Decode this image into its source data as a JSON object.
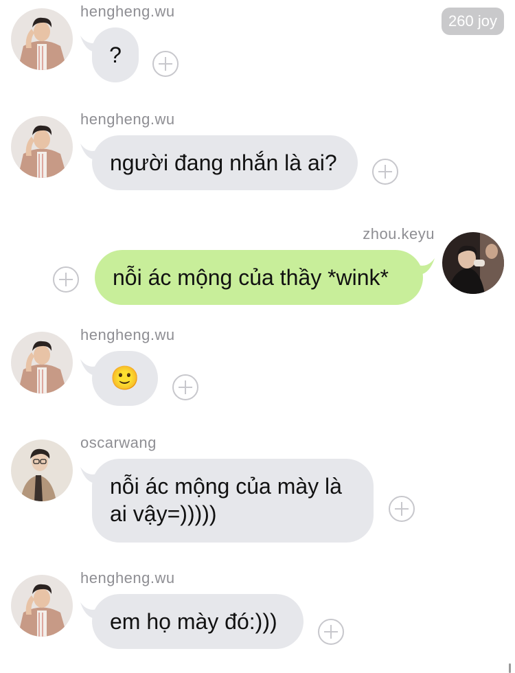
{
  "badge": {
    "label": "260 joy"
  },
  "messages": [
    {
      "sender": "hengheng.wu",
      "text": "?"
    },
    {
      "sender": "hengheng.wu",
      "text": "người đang nhắn là ai?"
    },
    {
      "sender": "zhou.keyu",
      "text": "nỗi ác mộng của thầy *wink*"
    },
    {
      "sender": "hengheng.wu",
      "text": "🙂"
    },
    {
      "sender": "oscarwang",
      "text_line1": "nỗi ác mộng của mày là",
      "text_line2": "ai vậy=)))))"
    },
    {
      "sender": "hengheng.wu",
      "text": "em họ mày đó:)))"
    }
  ],
  "colors": {
    "incoming_bubble": "#e6e7eb",
    "outgoing_bubble": "#c8ee9a",
    "name_text": "#8e8e93",
    "badge_bg": "#c9c9cb"
  },
  "icons": {
    "add": "plus-circle-icon",
    "emoji": "slightly-smiling-face"
  }
}
